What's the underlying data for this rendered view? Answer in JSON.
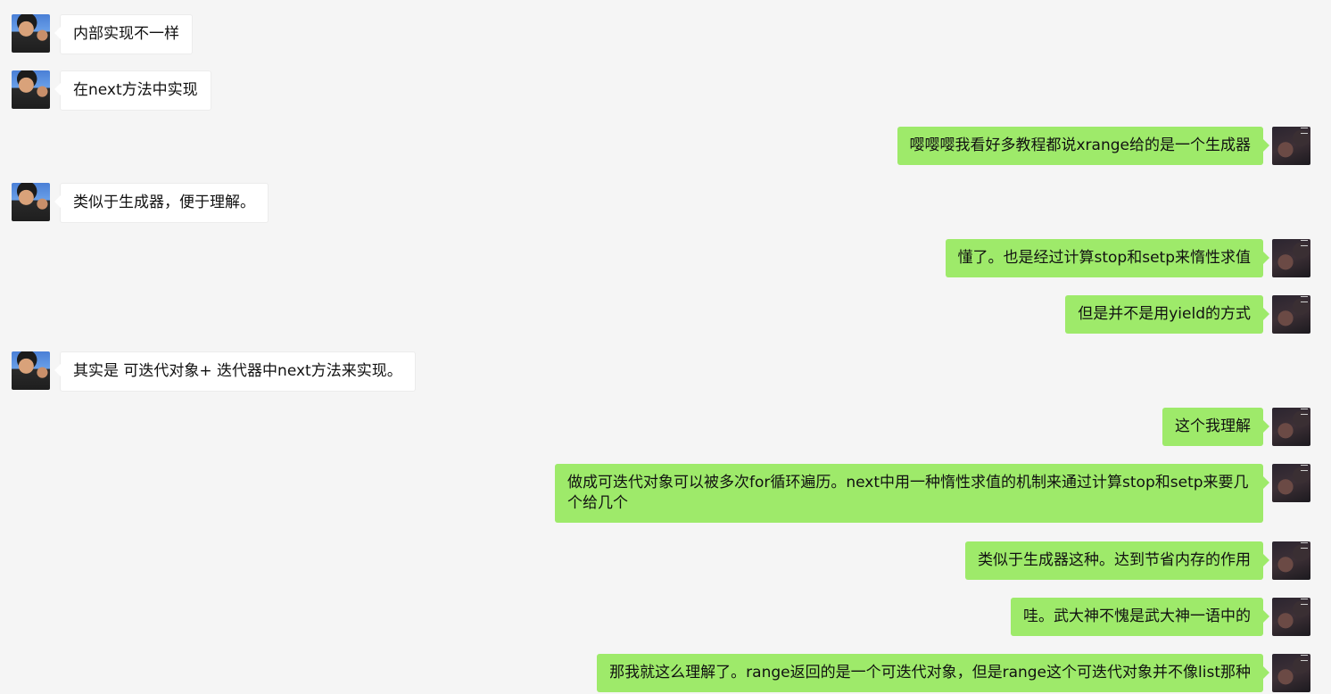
{
  "messages": [
    {
      "side": "left",
      "text": "内部实现不一样"
    },
    {
      "side": "left",
      "text": "在next方法中实现"
    },
    {
      "side": "right",
      "text": "嘤嘤嘤我看好多教程都说xrange给的是一个生成器"
    },
    {
      "side": "left",
      "text": "类似于生成器，便于理解。"
    },
    {
      "side": "right",
      "text": "懂了。也是经过计算stop和setp来惰性求值"
    },
    {
      "side": "right",
      "text": "但是并不是用yield的方式"
    },
    {
      "side": "left",
      "text": "其实是 可迭代对象+ 迭代器中next方法来实现。"
    },
    {
      "side": "right",
      "text": "这个我理解"
    },
    {
      "side": "right",
      "text": "做成可迭代对象可以被多次for循环遍历。next中用一种惰性求值的机制来通过计算stop和setp来要几个给几个"
    },
    {
      "side": "right",
      "text": "类似于生成器这种。达到节省内存的作用"
    },
    {
      "side": "right",
      "text": "哇。武大神不愧是武大神一语中的"
    },
    {
      "side": "right",
      "text": "那我就这么理解了。range返回的是一个可迭代对象，但是range这个可迭代对象并不像list那种"
    }
  ],
  "colors": {
    "background": "#f5f5f5",
    "received_bubble": "#ffffff",
    "sent_bubble": "#9eea6a"
  }
}
